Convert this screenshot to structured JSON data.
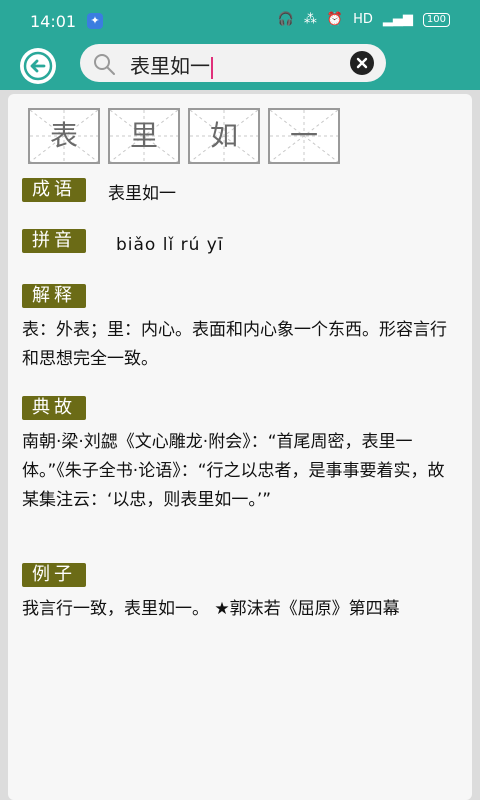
{
  "status_bar": {
    "time": "14:01",
    "network": "HD",
    "battery": "100"
  },
  "search": {
    "query": "表里如一"
  },
  "idiom": {
    "chars": [
      "表",
      "里",
      "如",
      "一"
    ],
    "sections": {
      "chengyu": {
        "label": "成语",
        "text": "表里如一"
      },
      "pinyin": {
        "label": "拼音",
        "text": "biǎo lǐ rú yī"
      },
      "jieshi": {
        "label": "解释",
        "text": "表：外表；里：内心。表面和内心象一个东西。形容言行和思想完全一致。"
      },
      "diangu": {
        "label": "典故",
        "text": "南朝·梁·刘勰《文心雕龙·附会》：“首尾周密，表里一体。”《朱子全书·论语》：“行之以忠者，是事事要着实，故某集注云：‘以忠，则表里如一。’”"
      },
      "lizi": {
        "label": "例子",
        "text": "我言行一致，表里如一。 ★郭沫若《屈原》第四幕"
      }
    }
  }
}
